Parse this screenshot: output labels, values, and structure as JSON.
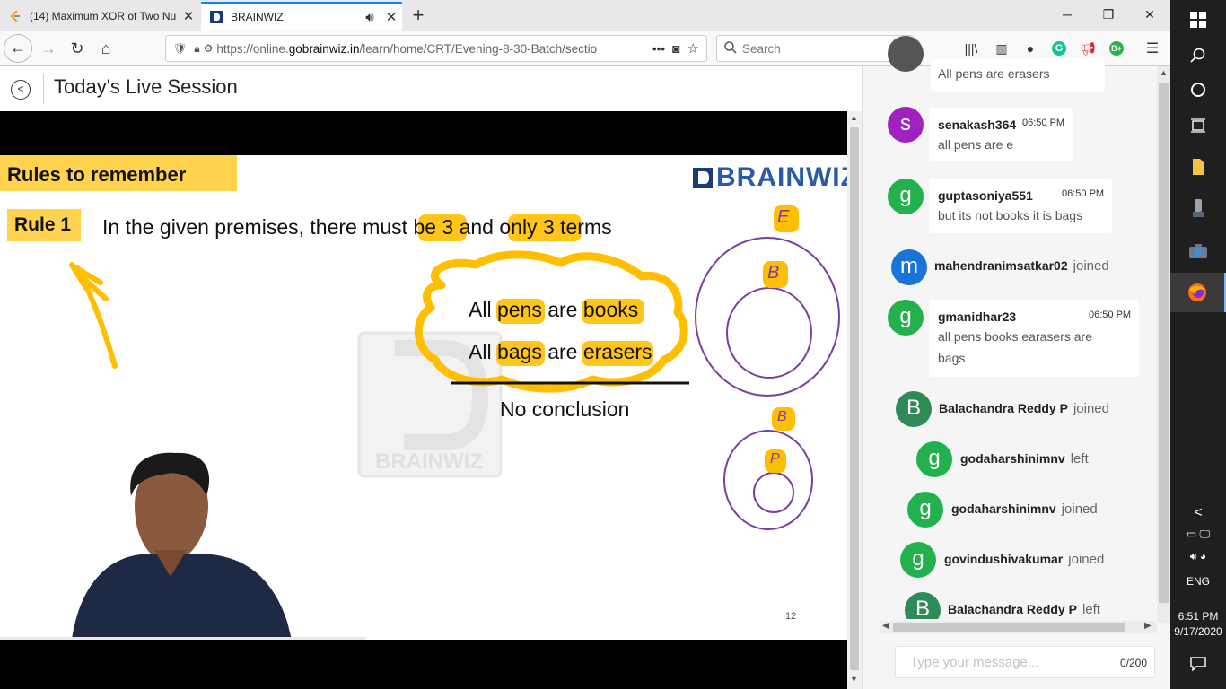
{
  "browser": {
    "tabs": [
      {
        "title": "(14) Maximum XOR of Two Nu",
        "active": false
      },
      {
        "title": "BRAINWIZ",
        "active": true
      }
    ],
    "new_tab": "+",
    "url_prefix": "https://online.",
    "url_domain": "gobrainwiz.in",
    "url_rest": "/learn/home/CRT/Evening-8-30-Batch/sectio",
    "url_more": "•••",
    "search_placeholder": "Search"
  },
  "page": {
    "title": "Today's Live Session"
  },
  "slide": {
    "heading": "Rules to remember",
    "logo_text": "BRAINWIZ",
    "watermark_text": "BRAINWIZ",
    "rule_label": "Rule 1",
    "rule_text": {
      "pre": "In the given premises, there must ",
      "hl1": "be 3",
      "mid": " and ",
      "hl2": "only 3",
      "post": " terms"
    },
    "premise1": {
      "a": "All ",
      "b": "pens",
      "c": " are ",
      "d": "books"
    },
    "premise2": {
      "a": "All ",
      "b": "bags",
      "c": " are ",
      "d": "erasers"
    },
    "conclusion": "No conclusion",
    "page_number": "12",
    "annotations": {
      "e": "E",
      "b1": "B",
      "b2": "B",
      "p": "P"
    }
  },
  "chat": {
    "messages": [
      {
        "type": "partial",
        "text": "All pens are erasers"
      },
      {
        "type": "message",
        "avatar": "s",
        "avatar_color": "#a020c0",
        "user": "senakash364",
        "time": "06:50 PM",
        "text": "all pens are e"
      },
      {
        "type": "message",
        "avatar": "g",
        "avatar_color": "#22b14c",
        "user": "guptasoniya551",
        "time": "06:50 PM",
        "text": "but its not books it is bags"
      },
      {
        "type": "event",
        "avatar": "m",
        "avatar_color": "#1a73d9",
        "user": "mahendranimsatkar02",
        "action": "joined"
      },
      {
        "type": "message",
        "avatar": "g",
        "avatar_color": "#22b14c",
        "user": "gmanidhar23",
        "time": "06:50 PM",
        "text": "all pens books earasers are bags"
      },
      {
        "type": "event",
        "avatar": "B",
        "avatar_color": "#2e8b57",
        "user": "Balachandra Reddy P",
        "action": "joined"
      },
      {
        "type": "event",
        "avatar": "g",
        "avatar_color": "#22b14c",
        "user": "godaharshinimnv",
        "action": "left"
      },
      {
        "type": "event",
        "avatar": "g",
        "avatar_color": "#22b14c",
        "user": "godaharshinimnv",
        "action": "joined"
      },
      {
        "type": "event",
        "avatar": "g",
        "avatar_color": "#22b14c",
        "user": "govindushivakumar",
        "action": "joined"
      },
      {
        "type": "event",
        "avatar": "B",
        "avatar_color": "#2e8b57",
        "user": "Balachandra Reddy P",
        "action": "left"
      }
    ],
    "input_placeholder": "Type your message...",
    "char_count": "0/200"
  },
  "taskbar": {
    "language": "ENG",
    "time": "6:51 PM",
    "date": "9/17/2020"
  },
  "colors": {
    "accent": "#0a84ff",
    "highlight": "#ffb800",
    "slide_heading_bg": "#ffd34d",
    "circle_stroke": "#7a3fa0"
  }
}
